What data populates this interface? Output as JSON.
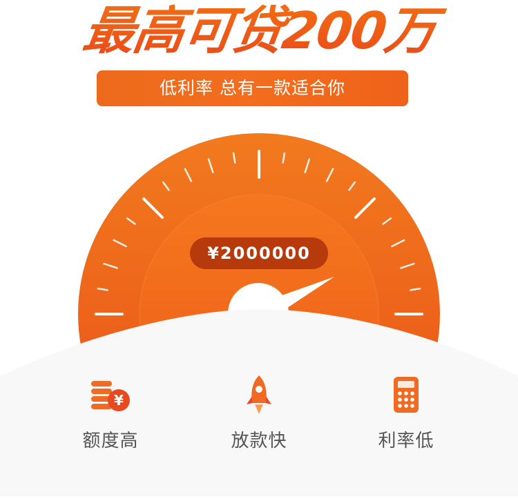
{
  "hero": {
    "title": "最高可贷200万",
    "subtitle": "低利率 总有一款适合你"
  },
  "gauge": {
    "amount": "¥2000000",
    "needle_percent": 80
  },
  "features": [
    {
      "icon": "coins-yen-icon",
      "label": "额度高"
    },
    {
      "icon": "rocket-icon",
      "label": "放款快"
    },
    {
      "icon": "calculator-icon",
      "label": "利率低"
    }
  ],
  "colors": {
    "accent": "#f0601a",
    "accent_dark": "#b63a0b",
    "text_gray": "#555555"
  }
}
